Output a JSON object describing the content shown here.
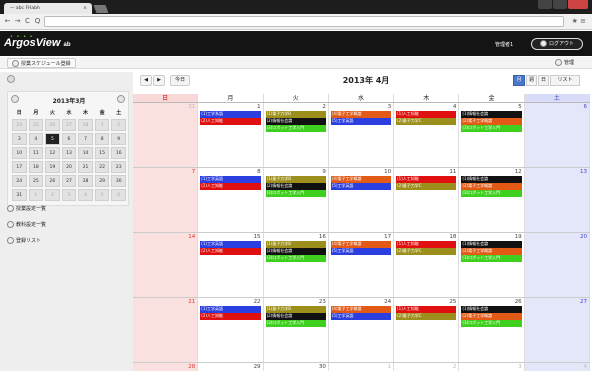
{
  "browser": {
    "tab_title": "— abc FHabh",
    "tab_close": "×",
    "url": "",
    "right_icons": "★ ≡",
    "nav_back": "←",
    "nav_fwd": "→",
    "nav_reload": "C",
    "nav_home": "Q"
  },
  "app": {
    "logo": "ArgosView",
    "logo_suffix": "ab",
    "user": "管理者1",
    "logout": "ログアウト"
  },
  "toolbar": {
    "register": "授業スケジュール登録",
    "manage": "管理"
  },
  "mini_calendar": {
    "title": "2013年3月",
    "weekday_headers": [
      "日",
      "月",
      "火",
      "水",
      "木",
      "金",
      "土"
    ],
    "weeks": [
      [
        {
          "d": "24",
          "o": true
        },
        {
          "d": "25",
          "o": true
        },
        {
          "d": "26",
          "o": true
        },
        {
          "d": "27",
          "o": true
        },
        {
          "d": "28",
          "o": true
        },
        {
          "d": "1",
          "o": true
        },
        {
          "d": "2",
          "o": true
        }
      ],
      [
        {
          "d": "3",
          "o": false
        },
        {
          "d": "4",
          "o": false
        },
        {
          "d": "5",
          "o": false,
          "today": true
        },
        {
          "d": "6",
          "o": false
        },
        {
          "d": "7",
          "o": false
        },
        {
          "d": "8",
          "o": false
        },
        {
          "d": "9",
          "o": false
        }
      ],
      [
        {
          "d": "10",
          "o": false
        },
        {
          "d": "11",
          "o": false
        },
        {
          "d": "12",
          "o": false
        },
        {
          "d": "13",
          "o": false
        },
        {
          "d": "14",
          "o": false
        },
        {
          "d": "15",
          "o": false
        },
        {
          "d": "16",
          "o": false
        }
      ],
      [
        {
          "d": "17",
          "o": false
        },
        {
          "d": "18",
          "o": false
        },
        {
          "d": "19",
          "o": false
        },
        {
          "d": "20",
          "o": false
        },
        {
          "d": "21",
          "o": false
        },
        {
          "d": "22",
          "o": false
        },
        {
          "d": "23",
          "o": false
        }
      ],
      [
        {
          "d": "24",
          "o": false
        },
        {
          "d": "25",
          "o": false
        },
        {
          "d": "26",
          "o": false
        },
        {
          "d": "27",
          "o": false
        },
        {
          "d": "28",
          "o": false
        },
        {
          "d": "29",
          "o": false
        },
        {
          "d": "30",
          "o": false
        }
      ],
      [
        {
          "d": "31",
          "o": false
        },
        {
          "d": "1",
          "o": true
        },
        {
          "d": "2",
          "o": true
        },
        {
          "d": "3",
          "o": true
        },
        {
          "d": "4",
          "o": true
        },
        {
          "d": "5",
          "o": true
        },
        {
          "d": "6",
          "o": true
        }
      ]
    ]
  },
  "sidebar": {
    "items": [
      "授業設定一覧",
      "教科設定一覧",
      "登録リスト"
    ]
  },
  "calendar": {
    "prev": "◀",
    "next": "▶",
    "today": "今日",
    "title": "2013年 4月",
    "views": [
      "月",
      "週",
      "日",
      "リスト"
    ],
    "active_view": 0,
    "weekdays": [
      "日",
      "月",
      "火",
      "水",
      "木",
      "金",
      "土"
    ],
    "colors": {
      "blue": "#2b3ee0",
      "red": "#e01010",
      "olive": "#9c8f1c",
      "green": "#3fcf1f",
      "orange": "#e25a16",
      "black": "#111111"
    },
    "weeks": [
      {
        "days": [
          {
            "n": "31",
            "dim": true,
            "ev": []
          },
          {
            "n": "1",
            "ev": [
              [
                "blue",
                "(1)工学系語"
              ],
              [
                "red",
                "(2)人工知能"
              ]
            ]
          },
          {
            "n": "2",
            "ev": [
              [
                "olive",
                "(1)電子力学B"
              ],
              [
                "black",
                "(2)情報社会論"
              ],
              [
                "green",
                "(3)ロボット工学入門"
              ]
            ]
          },
          {
            "n": "3",
            "ev": [
              [
                "orange",
                "(4)電子工学概論"
              ],
              [
                "blue",
                "(5)工学英語"
              ]
            ]
          },
          {
            "n": "4",
            "ev": [
              [
                "red",
                "(1)人工知能"
              ],
              [
                "olive",
                "(2)量子力学C"
              ]
            ]
          },
          {
            "n": "5",
            "ev": [
              [
                "black",
                "(1)情報社会論"
              ],
              [
                "orange",
                "(2)電子工学概論"
              ],
              [
                "green",
                "(3)ロボット工学入門"
              ]
            ]
          },
          {
            "n": "6",
            "ev": []
          }
        ]
      },
      {
        "days": [
          {
            "n": "7",
            "ev": []
          },
          {
            "n": "8",
            "ev": [
              [
                "blue",
                "(1)工学英語"
              ],
              [
                "red",
                "(2)人工知能"
              ]
            ]
          },
          {
            "n": "9",
            "ev": [
              [
                "olive",
                "(1)量子力学B"
              ],
              [
                "black",
                "(2)情報社会論"
              ],
              [
                "green",
                "(3)ロボット工学入門"
              ]
            ]
          },
          {
            "n": "10",
            "ev": [
              [
                "orange",
                "(4)電子工学概論"
              ],
              [
                "blue",
                "(5)工学英語"
              ]
            ]
          },
          {
            "n": "11",
            "ev": [
              [
                "red",
                "(1)人工知能"
              ],
              [
                "olive",
                "(2)量子力学C"
              ]
            ]
          },
          {
            "n": "12",
            "ev": [
              [
                "black",
                "(1)情報社会論"
              ],
              [
                "orange",
                "(2)電子工学概論"
              ],
              [
                "green",
                "(3)ロボット工学入門"
              ]
            ]
          },
          {
            "n": "13",
            "ev": []
          }
        ]
      },
      {
        "days": [
          {
            "n": "14",
            "ev": []
          },
          {
            "n": "15",
            "ev": [
              [
                "blue",
                "(1)工学英語"
              ],
              [
                "red",
                "(2)人工知能"
              ]
            ]
          },
          {
            "n": "16",
            "ev": [
              [
                "olive",
                "(1)量子力学B"
              ],
              [
                "black",
                "(2)情報社会論"
              ],
              [
                "green",
                "(3)ロボット工学入門"
              ]
            ]
          },
          {
            "n": "17",
            "ev": [
              [
                "orange",
                "(4)電子工学概論"
              ],
              [
                "blue",
                "(5)工学英語"
              ]
            ]
          },
          {
            "n": "18",
            "ev": [
              [
                "red",
                "(1)人工知能"
              ],
              [
                "olive",
                "(2)量子力学C"
              ]
            ]
          },
          {
            "n": "19",
            "ev": [
              [
                "black",
                "(1)情報社会論"
              ],
              [
                "orange",
                "(2)電子工学概論"
              ],
              [
                "green",
                "(3)ロボット工学入門"
              ]
            ]
          },
          {
            "n": "20",
            "ev": []
          }
        ]
      },
      {
        "days": [
          {
            "n": "21",
            "ev": []
          },
          {
            "n": "22",
            "ev": [
              [
                "blue",
                "(1)工学英語"
              ],
              [
                "red",
                "(2)人工知能"
              ]
            ]
          },
          {
            "n": "23",
            "ev": [
              [
                "olive",
                "(1)量子力学B"
              ],
              [
                "black",
                "(2)情報社会論"
              ],
              [
                "green",
                "(3)ロボット工学入門"
              ]
            ]
          },
          {
            "n": "24",
            "ev": [
              [
                "orange",
                "(4)電子工学概論"
              ],
              [
                "blue",
                "(5)工学英語"
              ]
            ]
          },
          {
            "n": "25",
            "ev": [
              [
                "red",
                "(1)人工知能"
              ],
              [
                "olive",
                "(2)量子力学C"
              ]
            ]
          },
          {
            "n": "26",
            "ev": [
              [
                "black",
                "(1)情報社会論"
              ],
              [
                "orange",
                "(2)電子工学概論"
              ],
              [
                "green",
                "(3)ロボット工学入門"
              ]
            ]
          },
          {
            "n": "27",
            "ev": []
          }
        ]
      },
      {
        "days": [
          {
            "n": "28",
            "ev": []
          },
          {
            "n": "29",
            "ev": []
          },
          {
            "n": "30",
            "ev": []
          },
          {
            "n": "1",
            "dim": true,
            "ev": []
          },
          {
            "n": "2",
            "dim": true,
            "ev": []
          },
          {
            "n": "3",
            "dim": true,
            "ev": []
          },
          {
            "n": "4",
            "dim": true,
            "ev": []
          }
        ]
      }
    ]
  }
}
